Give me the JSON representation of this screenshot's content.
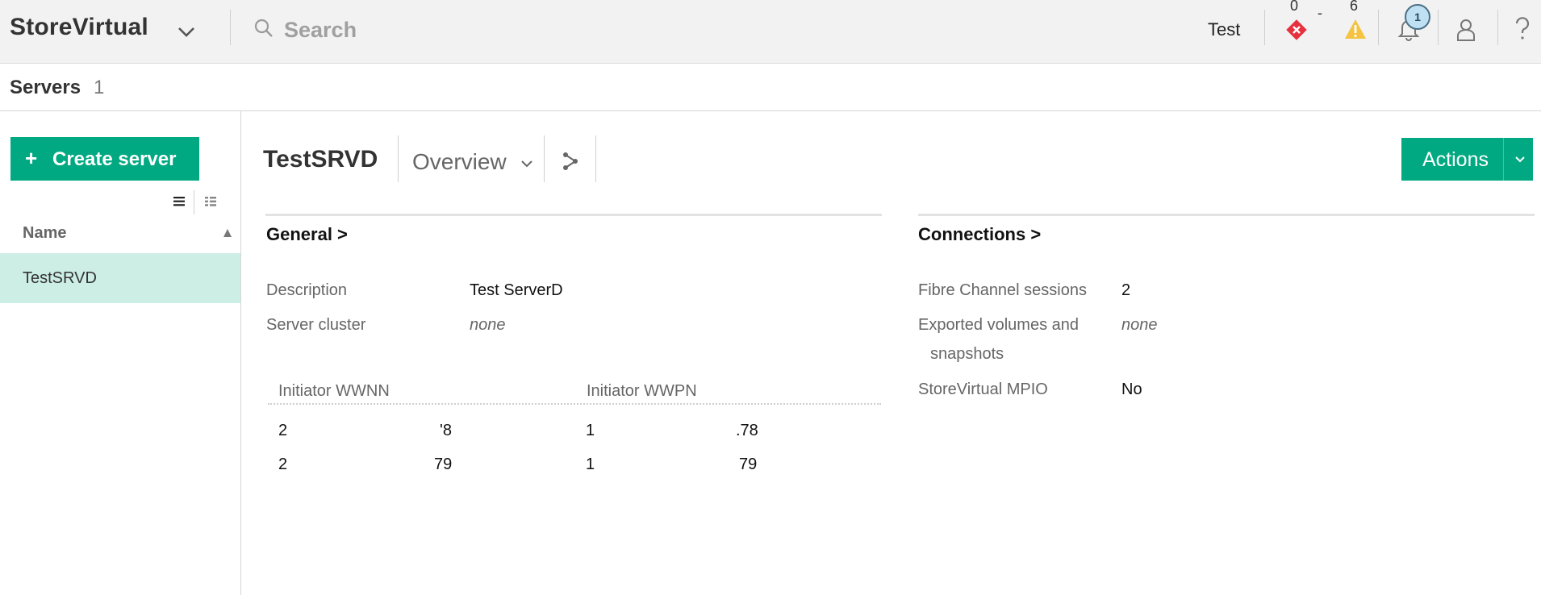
{
  "header": {
    "app_name": "StoreVirtual",
    "search_placeholder": "Search",
    "user_label": "Test",
    "critical_count": "0",
    "separator": "-",
    "warning_count": "6",
    "notifications_badge": "1",
    "colors": {
      "accent": "#01a982",
      "critical": "#e5323e",
      "warning": "#f5c342"
    }
  },
  "breadcrumb": {
    "title": "Servers",
    "count": "1"
  },
  "sidebar": {
    "create_label": "Create server",
    "create_plus": "+",
    "column_name": "Name",
    "rows": [
      {
        "name": "TestSRVD"
      }
    ]
  },
  "main": {
    "title": "TestSRVD",
    "view_label": "Overview",
    "actions_label": "Actions",
    "general": {
      "title": "General >",
      "fields": [
        {
          "label": "Description",
          "value": "Test ServerD"
        },
        {
          "label": "Server cluster",
          "value": "none"
        }
      ],
      "wwn_headers": [
        "Initiator WWNN",
        "Initiator WWPN"
      ],
      "wwn_rows": [
        {
          "wwnn_start": "2",
          "wwnn_end": "'8",
          "wwpn_start": "1",
          "wwpn_end": ".78"
        },
        {
          "wwnn_start": "2",
          "wwnn_end": "79",
          "wwpn_start": "1",
          "wwpn_end": "79"
        }
      ]
    },
    "connections": {
      "title": "Connections >",
      "fields": [
        {
          "label": "Fibre Channel sessions",
          "value": "2"
        },
        {
          "label_line1": "Exported volumes and",
          "label_line2": "snapshots",
          "value": "none"
        },
        {
          "label": "StoreVirtual MPIO",
          "value": "No"
        }
      ]
    }
  }
}
